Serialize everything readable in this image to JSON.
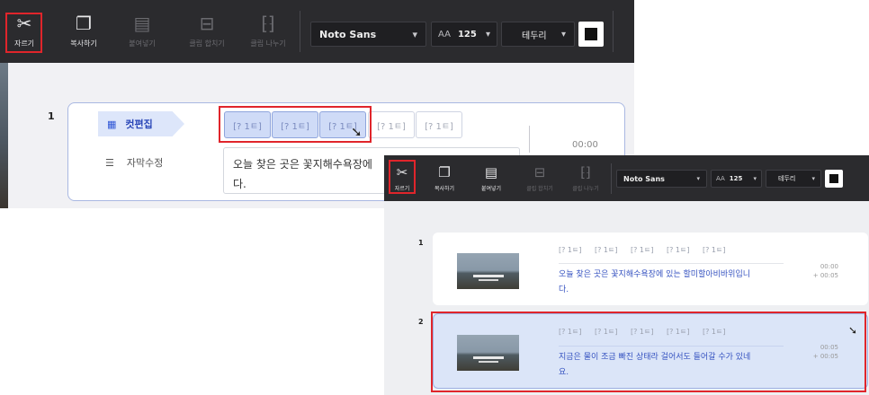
{
  "toolbar": {
    "cut": "자르기",
    "copy": "복사하기",
    "paste": "붙여넣기",
    "merge": "클립 합치기",
    "split": "클립 나누기",
    "font": "Noto Sans",
    "size_icon": "AA",
    "size": "125",
    "outline": "테두리",
    "caret": "▾"
  },
  "panel1": {
    "row_number": "1",
    "tab_edit": "컷편집",
    "tab_subtitle": "자막수정",
    "clips": [
      "[? 1ㅌ]",
      "[? 1ㅌ]",
      "[? 1ㅌ]",
      "[? 1ㅌ]",
      "[? 1ㅌ]"
    ],
    "text_line1": "오늘 찾은 곳은 꽃지해수욕장에",
    "text_line2": "다.",
    "time": "00:00"
  },
  "panel2": {
    "segments": [
      {
        "number": "1",
        "chips": [
          "[? 1ㅌ]",
          "[? 1ㅌ]",
          "[? 1ㅌ]",
          "[? 1ㅌ]",
          "[? 1ㅌ]"
        ],
        "line1": "오늘 찾은 곳은 꽃지해수욕장에 있는 할미할아비바위입니",
        "line2": "다.",
        "time_start": "00:00",
        "time_dur": "+ 00:05"
      },
      {
        "number": "2",
        "chips": [
          "[? 1ㅌ]",
          "[? 1ㅌ]",
          "[? 1ㅌ]",
          "[? 1ㅌ]",
          "[? 1ㅌ]"
        ],
        "line1": "지금은 물이 조금 빠진 상태라 걸어서도 들어갈 수가 있네",
        "line2": "요.",
        "time_start": "00:05",
        "time_dur": "+ 00:05"
      }
    ]
  },
  "colors": {
    "toolbar": "#2b2b2e",
    "highlight": "#e0252b",
    "accent": "#2f56d6",
    "selected": "#dbe5f8"
  },
  "icons": [
    "scissors-icon",
    "copy-icon",
    "paste-icon",
    "merge-icon",
    "split-icon",
    "font-size-icon",
    "chevron-down-icon",
    "clapper-icon",
    "subtitle-icon",
    "cursor-icon"
  ]
}
